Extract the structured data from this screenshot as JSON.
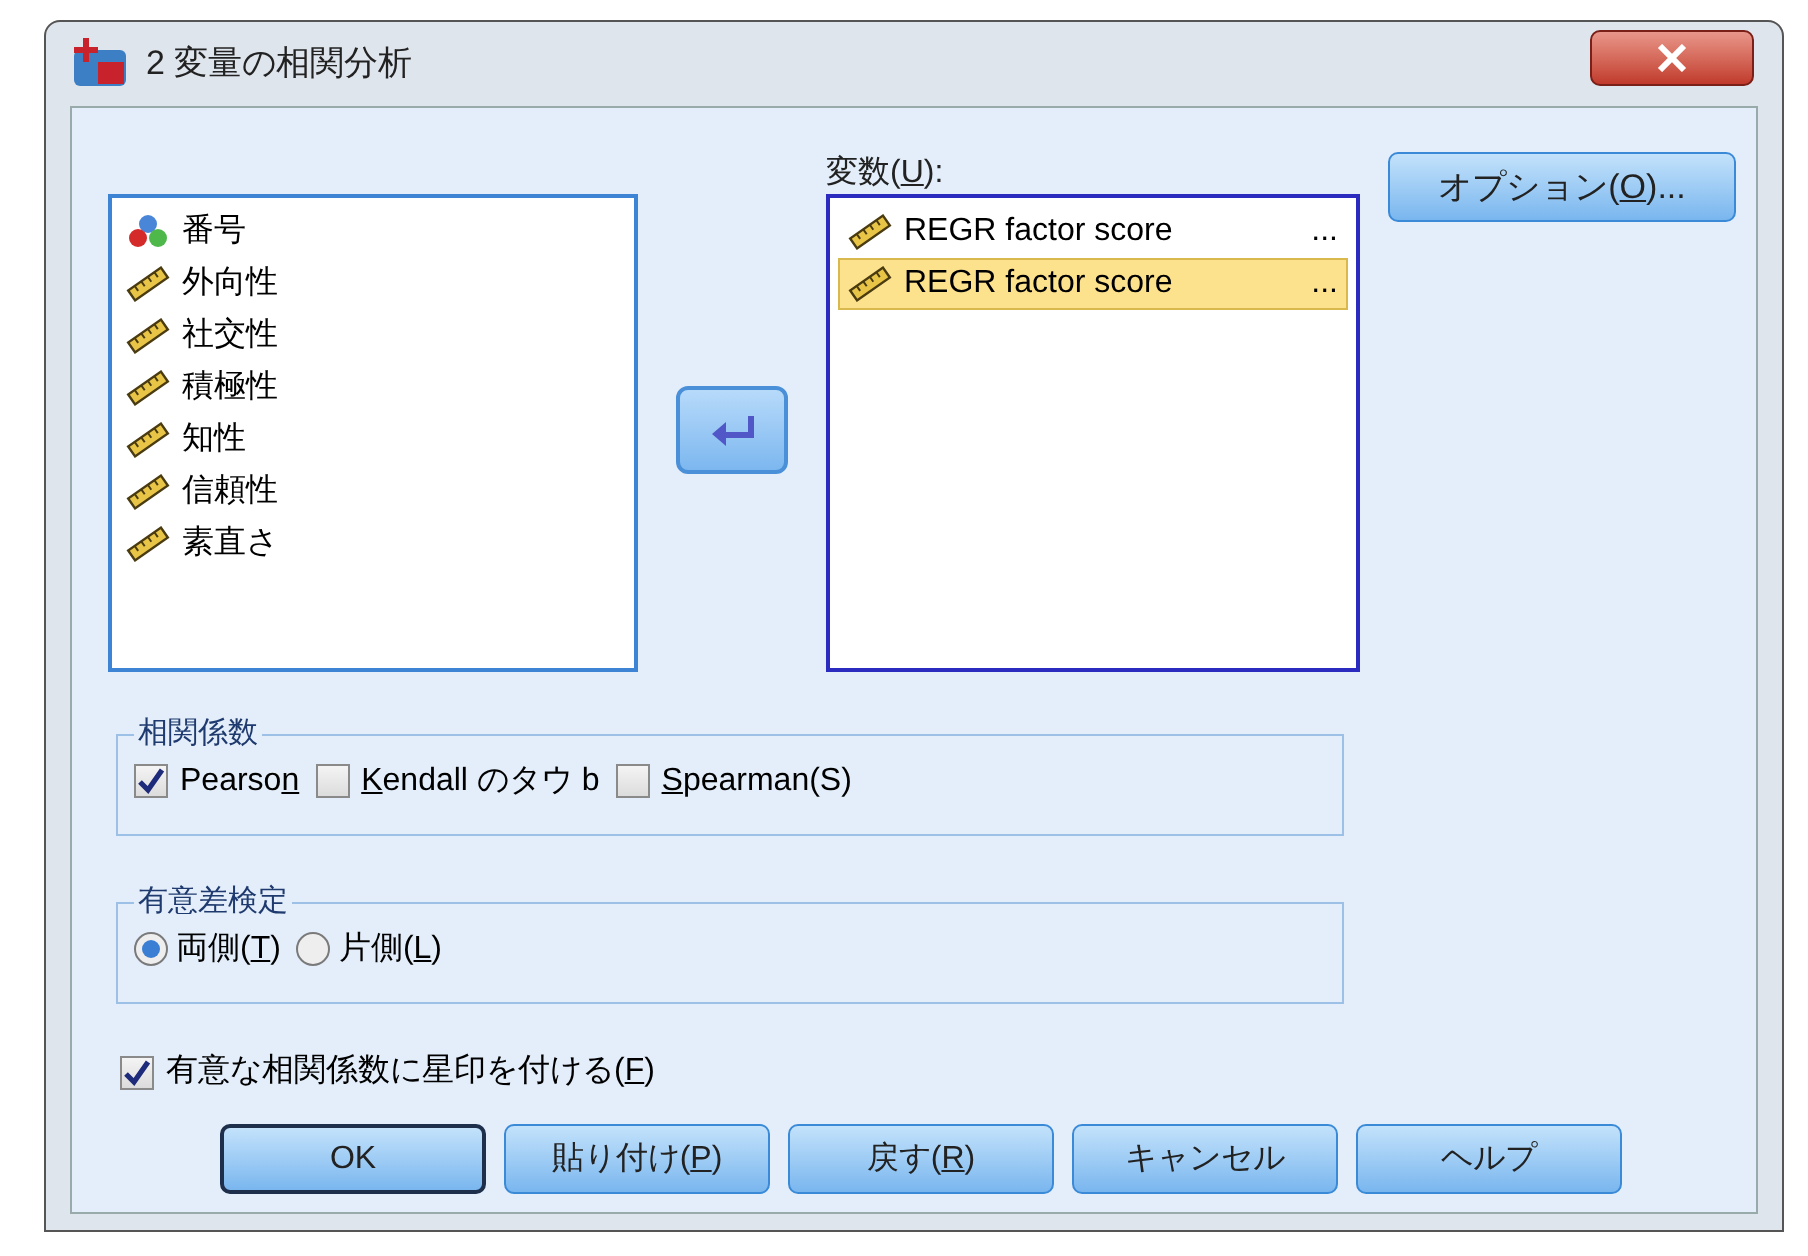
{
  "window": {
    "title": "2 変量の相関分析"
  },
  "source_list": {
    "items": [
      {
        "label": "番号",
        "kind": "nominal",
        "selected": false
      },
      {
        "label": "外向性",
        "kind": "scale",
        "selected": false
      },
      {
        "label": "社交性",
        "kind": "scale",
        "selected": false
      },
      {
        "label": "積極性",
        "kind": "scale",
        "selected": false
      },
      {
        "label": "知性",
        "kind": "scale",
        "selected": false
      },
      {
        "label": "信頼性",
        "kind": "scale",
        "selected": false
      },
      {
        "label": "素直さ",
        "kind": "scale",
        "selected": false
      }
    ]
  },
  "variables": {
    "label_before": "変数(",
    "mnemonic": "U",
    "label_after": "):",
    "items": [
      {
        "label": "REGR factor score",
        "suffix": "...",
        "kind": "scale",
        "selected": false
      },
      {
        "label": "REGR factor score",
        "suffix": "...",
        "kind": "scale",
        "selected": true
      }
    ]
  },
  "options_button": {
    "label_before": "オプション(",
    "mnemonic": "O",
    "label_after": ")..."
  },
  "coefficients": {
    "title": "相関係数",
    "options": [
      {
        "label_before": "Pearso",
        "mnemonic": "n",
        "checked": true
      },
      {
        "mnemonic": "K",
        "label_after": "endall のタウ b",
        "checked": false
      },
      {
        "mnemonic": "S",
        "label_after": "pearman(S)",
        "checked": false
      }
    ]
  },
  "test": {
    "title": "有意差検定",
    "options": [
      {
        "label_before": "両側(",
        "mnemonic": "T",
        "label_after": ")",
        "selected": true
      },
      {
        "label_before": "片側(",
        "mnemonic": "L",
        "label_after": ")",
        "selected": false
      }
    ]
  },
  "flag": {
    "label_before": "有意な相関係数に星印を付ける(",
    "mnemonic": "F",
    "label_after": ")",
    "checked": true
  },
  "buttons": [
    {
      "label_before": "OK",
      "default": true
    },
    {
      "label_before": "貼り付け(",
      "mnemonic": "P",
      "label_after": ")",
      "default": false
    },
    {
      "label_before": "戻す(",
      "mnemonic": "R",
      "label_after": ")",
      "default": false
    },
    {
      "label_before": "キャンセル",
      "default": false
    },
    {
      "label_before": "ヘルプ",
      "default": false
    }
  ]
}
